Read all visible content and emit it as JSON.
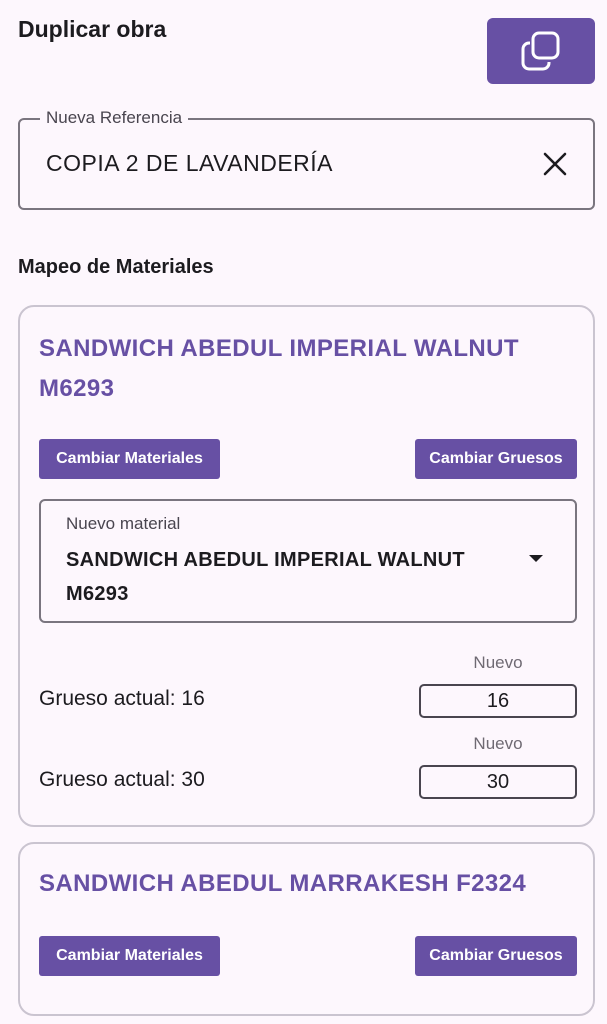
{
  "header": {
    "title": "Duplicar obra",
    "duplicate_icon": "copy-icon"
  },
  "reference": {
    "label": "Nueva Referencia",
    "value": "COPIA 2 DE LAVANDERÍA",
    "clear_icon": "close-icon"
  },
  "mapping": {
    "section_title": "Mapeo de Materiales",
    "materials": [
      {
        "name": "SANDWICH ABEDUL IMPERIAL WALNUT M6293",
        "change_materials_label": "Cambiar Materiales",
        "change_thickness_label": "Cambiar Gruesos",
        "new_material_label": "Nuevo material",
        "new_material_value": "SANDWICH ABEDUL IMPERIAL WALNUT M6293",
        "thicknesses": [
          {
            "current_label": "Grueso actual: 16",
            "new_label": "Nuevo",
            "new_value": "16"
          },
          {
            "current_label": "Grueso actual: 30",
            "new_label": "Nuevo",
            "new_value": "30"
          }
        ]
      },
      {
        "name": "SANDWICH ABEDUL MARRAKESH F2324",
        "change_materials_label": "Cambiar Materiales",
        "change_thickness_label": "Cambiar Gruesos"
      }
    ]
  },
  "colors": {
    "accent": "#6750a4",
    "background": "#fdf7fd",
    "outline": "#7a757f"
  }
}
